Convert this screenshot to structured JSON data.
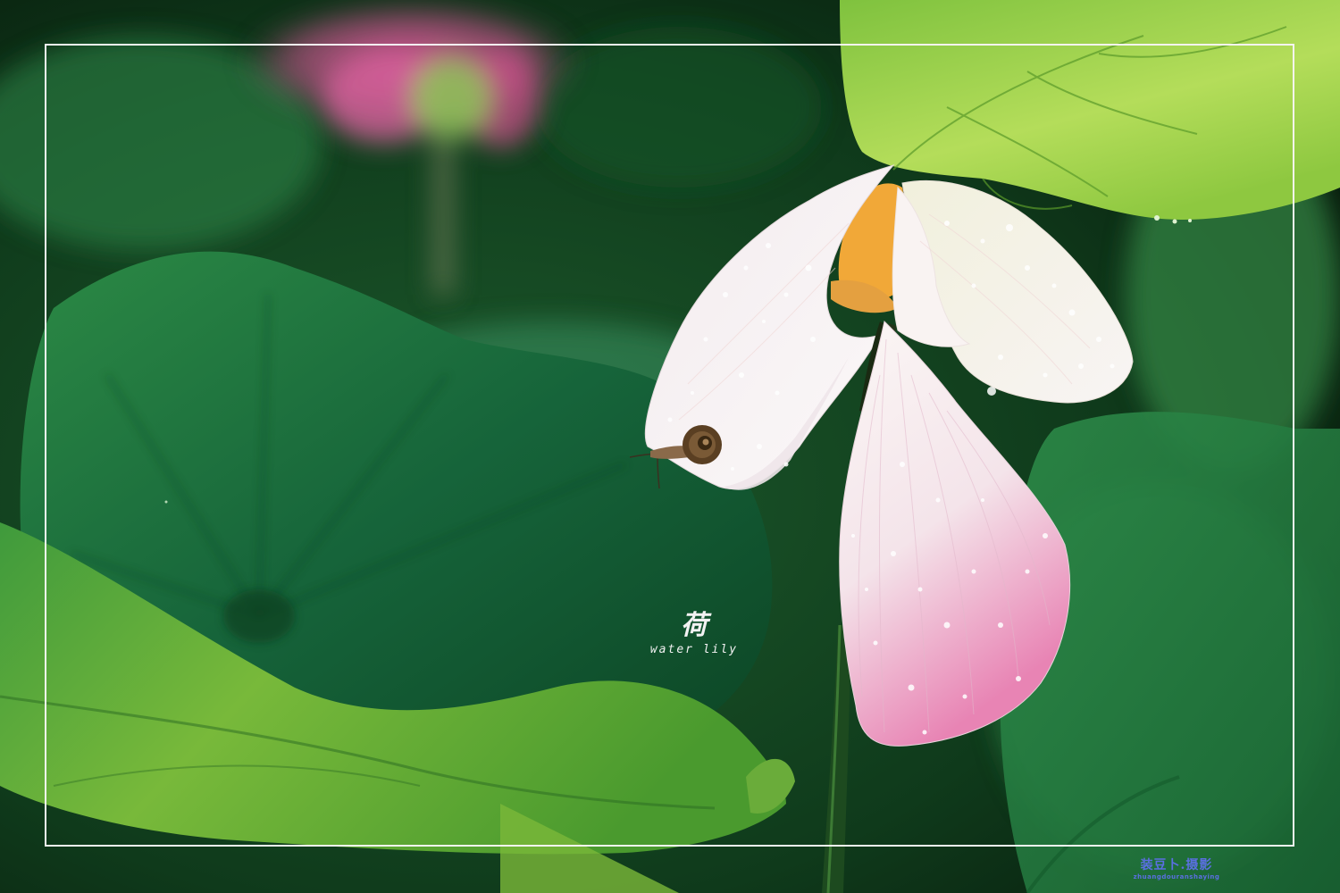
{
  "caption": {
    "title": "荷",
    "subtitle": "water  lily"
  },
  "watermark": {
    "main": "装豆卜.摄影",
    "sub": "zhuangdouranshaying"
  },
  "palette": {
    "leaf_dark": "#0f4a24",
    "leaf_mid": "#1f7a3a",
    "leaf_light": "#9ad04a",
    "petal_white": "#f6f0f1",
    "petal_pink": "#e07aa8",
    "frame": "#f4f4f4"
  },
  "scene": {
    "subject": "lotus-flower-icon",
    "detail": "snail-icon"
  }
}
